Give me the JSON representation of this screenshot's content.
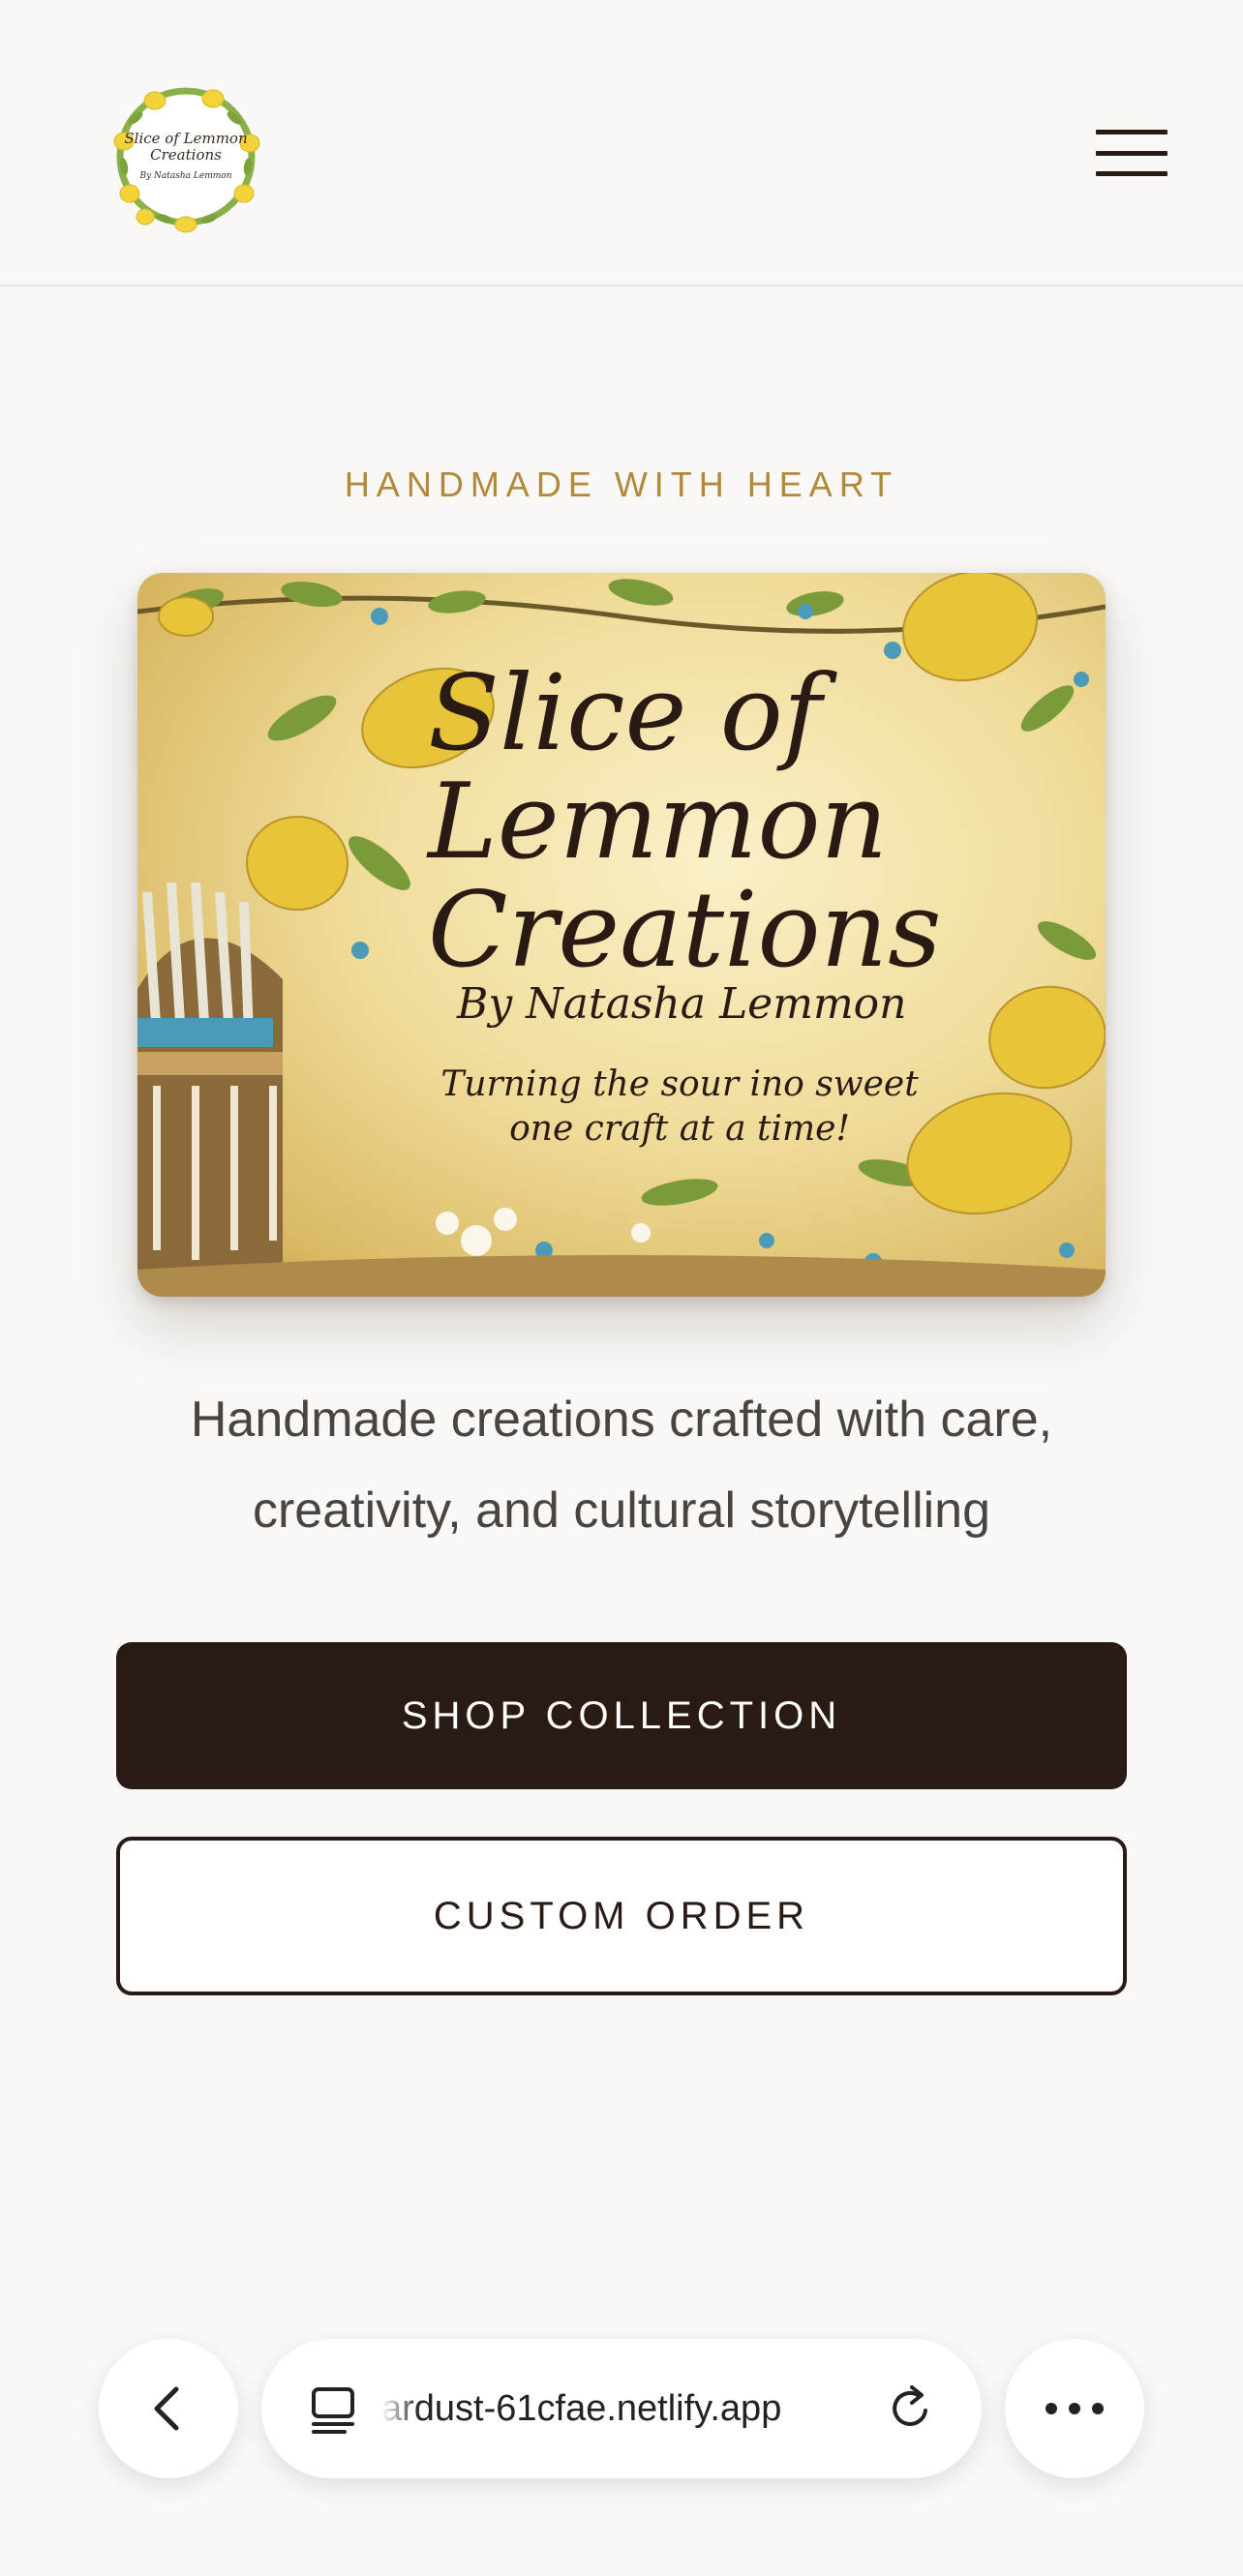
{
  "header": {
    "logo": {
      "line1": "Slice of Lemmon",
      "line2": "Creations",
      "line3": "By Natasha Lemmon",
      "icon": "lemon-wreath-logo"
    },
    "menu_icon": "hamburger-menu-icon"
  },
  "hero": {
    "eyebrow": "HANDMADE WITH HEART",
    "image": {
      "title": "Slice of Lemmon Creations",
      "subtitle": "By Natasha Lemmon",
      "tagline_line1": "Turning the sour ino sweet",
      "tagline_line2": "one craft at a time!"
    },
    "description": "Handmade creations crafted with care, creativity, and cultural storytelling",
    "primary_button": "SHOP COLLECTION",
    "secondary_button": "CUSTOM ORDER"
  },
  "browser_bar": {
    "back_icon": "chevron-left-icon",
    "tabs_icon": "tabs-icon",
    "url": "ardust-61cfae.netlify.app",
    "reload_icon": "reload-icon",
    "more_icon": "more-dots-icon"
  },
  "colors": {
    "background": "#f9f8f6",
    "accent_gold": "#b08a3a",
    "primary_dark": "#2a1a14"
  }
}
